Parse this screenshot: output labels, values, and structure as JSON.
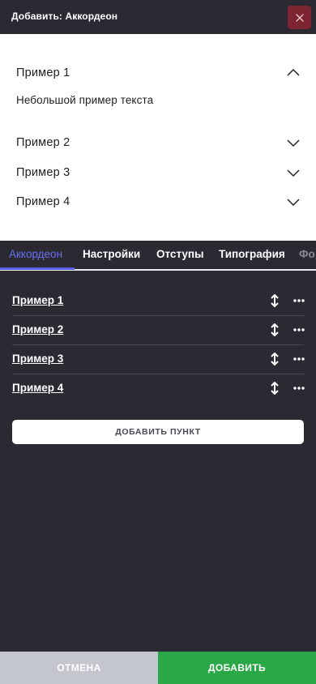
{
  "header": {
    "title": "Добавить: Аккордеон"
  },
  "preview": {
    "items": [
      {
        "label": "Пример 1",
        "expanded": true,
        "body": "Небольшой пример текста"
      },
      {
        "label": "Пример 2",
        "expanded": false
      },
      {
        "label": "Пример 3",
        "expanded": false
      },
      {
        "label": "Пример 4",
        "expanded": false
      }
    ]
  },
  "tabs": [
    {
      "label": "Аккордеон",
      "active": true
    },
    {
      "label": "Настройки"
    },
    {
      "label": "Отступы"
    },
    {
      "label": "Типография"
    },
    {
      "label": "Фо"
    }
  ],
  "list": {
    "items": [
      {
        "label": "Пример 1"
      },
      {
        "label": "Пример 2"
      },
      {
        "label": "Пример 3"
      },
      {
        "label": "Пример 4"
      }
    ],
    "add_label": "ДОБАВИТЬ ПУНКТ"
  },
  "footer": {
    "cancel_label": "ОТМЕНА",
    "add_label": "ДОБАВИТЬ"
  },
  "colors": {
    "background": "#2b2a33",
    "accent": "#5b5fe6",
    "close": "#7c2530",
    "confirm": "#2aa847",
    "cancel": "#c3c5cf"
  }
}
